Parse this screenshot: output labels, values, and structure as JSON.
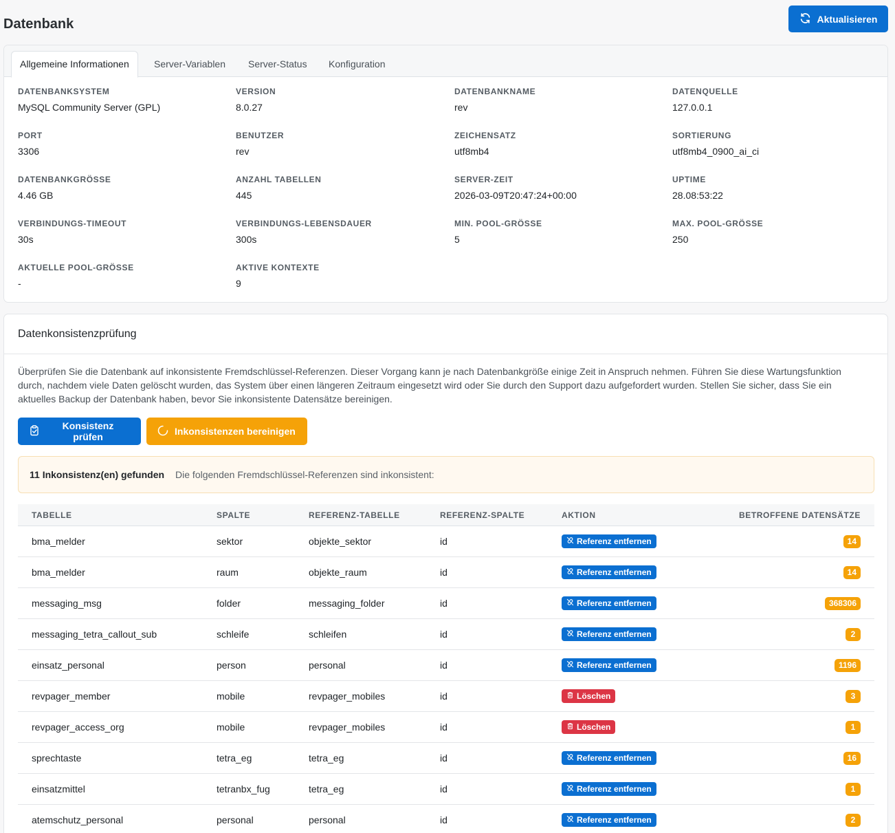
{
  "page": {
    "title": "Datenbank",
    "refresh_label": "Aktualisieren"
  },
  "tabs": [
    {
      "label": "Allgemeine Informationen",
      "active": true
    },
    {
      "label": "Server-Variablen",
      "active": false
    },
    {
      "label": "Server-Status",
      "active": false
    },
    {
      "label": "Konfiguration",
      "active": false
    }
  ],
  "info": [
    {
      "label": "Datenbanksystem",
      "value": "MySQL Community Server (GPL)"
    },
    {
      "label": "Version",
      "value": "8.0.27"
    },
    {
      "label": "Datenbankname",
      "value": "rev"
    },
    {
      "label": "Datenquelle",
      "value": "127.0.0.1"
    },
    {
      "label": "Port",
      "value": "3306"
    },
    {
      "label": "Benutzer",
      "value": "rev"
    },
    {
      "label": "Zeichensatz",
      "value": "utf8mb4"
    },
    {
      "label": "Sortierung",
      "value": "utf8mb4_0900_ai_ci"
    },
    {
      "label": "Datenbankgrösse",
      "value": "4.46 GB"
    },
    {
      "label": "Anzahl Tabellen",
      "value": "445"
    },
    {
      "label": "Server-Zeit",
      "value": "2026-03-09T20:47:24+00:00"
    },
    {
      "label": "Uptime",
      "value": "28.08:53:22"
    },
    {
      "label": "Verbindungs-Timeout",
      "value": "30s"
    },
    {
      "label": "Verbindungs-Lebensdauer",
      "value": "300s"
    },
    {
      "label": "Min. Pool-Grösse",
      "value": "5"
    },
    {
      "label": "Max. Pool-Grösse",
      "value": "250"
    },
    {
      "label": "Aktuelle Pool-Grösse",
      "value": "-"
    },
    {
      "label": "Aktive Kontexte",
      "value": "9"
    }
  ],
  "consistency": {
    "title": "Datenkonsistenzprüfung",
    "description": "Überprüfen Sie die Datenbank auf inkonsistente Fremdschlüssel-Referenzen. Dieser Vorgang kann je nach Datenbankgröße einige Zeit in Anspruch nehmen. Führen Sie diese Wartungsfunktion durch, nachdem viele Daten gelöscht wurden, das System über einen längeren Zeitraum eingesetzt wird oder Sie durch den Support dazu aufgefordert wurden. Stellen Sie sicher, dass Sie ein aktuelles Backup der Datenbank haben, bevor Sie inkonsistente Datensätze bereinigen.",
    "check_label": "Konsistenz prüfen",
    "clean_label": "Inkonsistenzen bereinigen",
    "alert_strong": "11 Inkonsistenz(en) gefunden",
    "alert_text": "Die folgenden Fremdschlüssel-Referenzen sind inkonsistent:",
    "columns": [
      "Tabelle",
      "Spalte",
      "Referenz-Tabelle",
      "Referenz-Spalte",
      "Aktion",
      "Betroffene Datensätze"
    ],
    "rows": [
      {
        "table": "bma_melder",
        "column": "sektor",
        "ref_table": "objekte_sektor",
        "ref_column": "id",
        "action": "Referenz entfernen",
        "action_type": "remove",
        "count": "14"
      },
      {
        "table": "bma_melder",
        "column": "raum",
        "ref_table": "objekte_raum",
        "ref_column": "id",
        "action": "Referenz entfernen",
        "action_type": "remove",
        "count": "14"
      },
      {
        "table": "messaging_msg",
        "column": "folder",
        "ref_table": "messaging_folder",
        "ref_column": "id",
        "action": "Referenz entfernen",
        "action_type": "remove",
        "count": "368306"
      },
      {
        "table": "messaging_tetra_callout_sub",
        "column": "schleife",
        "ref_table": "schleifen",
        "ref_column": "id",
        "action": "Referenz entfernen",
        "action_type": "remove",
        "count": "2"
      },
      {
        "table": "einsatz_personal",
        "column": "person",
        "ref_table": "personal",
        "ref_column": "id",
        "action": "Referenz entfernen",
        "action_type": "remove",
        "count": "1196"
      },
      {
        "table": "revpager_member",
        "column": "mobile",
        "ref_table": "revpager_mobiles",
        "ref_column": "id",
        "action": "Löschen",
        "action_type": "delete",
        "count": "3"
      },
      {
        "table": "revpager_access_org",
        "column": "mobile",
        "ref_table": "revpager_mobiles",
        "ref_column": "id",
        "action": "Löschen",
        "action_type": "delete",
        "count": "1"
      },
      {
        "table": "sprechtaste",
        "column": "tetra_eg",
        "ref_table": "tetra_eg",
        "ref_column": "id",
        "action": "Referenz entfernen",
        "action_type": "remove",
        "count": "16"
      },
      {
        "table": "einsatzmittel",
        "column": "tetranbx_fug",
        "ref_table": "tetra_eg",
        "ref_column": "id",
        "action": "Referenz entfernen",
        "action_type": "remove",
        "count": "1"
      },
      {
        "table": "atemschutz_personal",
        "column": "personal",
        "ref_table": "personal",
        "ref_column": "id",
        "action": "Referenz entfernen",
        "action_type": "remove",
        "count": "2"
      }
    ]
  },
  "colors": {
    "primary": "#0b6fd1",
    "warning": "#f5a208",
    "danger": "#dc3545"
  }
}
